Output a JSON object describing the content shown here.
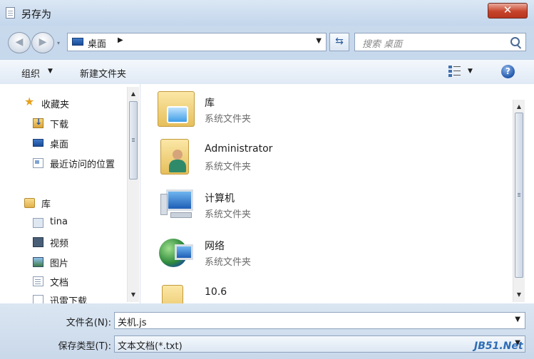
{
  "window": {
    "title": "另存为",
    "close_glyph": "✕"
  },
  "navbar": {
    "back_glyph": "◀",
    "forward_glyph": "▶",
    "recent_glyph": "▾",
    "address_location": "桌面",
    "address_arrow": "▶",
    "address_dropdown_glyph": "▼",
    "refresh_glyph": "⇆",
    "search_placeholder": "搜索 桌面"
  },
  "toolbar": {
    "organize_label": "组织",
    "organize_caret": "▼",
    "new_folder_label": "新建文件夹",
    "view_dropdown_glyph": "▼",
    "help_glyph": "?"
  },
  "nav_pane": {
    "items": [
      {
        "label": "收藏夹",
        "icon": "star-icon"
      },
      {
        "label": "下载",
        "icon": "downloads-icon"
      },
      {
        "label": "桌面",
        "icon": "desktop-icon"
      },
      {
        "label": "最近访问的位置",
        "icon": "recent-places-icon"
      },
      {
        "label": "库",
        "icon": "library-icon"
      },
      {
        "label": "tina",
        "icon": "user-folder-icon"
      },
      {
        "label": "视频",
        "icon": "video-library-icon"
      },
      {
        "label": "图片",
        "icon": "pictures-library-icon"
      },
      {
        "label": "文档",
        "icon": "documents-library-icon"
      },
      {
        "label": "迅雷下载",
        "icon": "thunder-download-icon"
      }
    ],
    "scroll_up_glyph": "▲",
    "scroll_down_glyph": "▼"
  },
  "file_pane": {
    "items": [
      {
        "name": "库",
        "type": "系统文件夹",
        "icon": "library-folder-icon"
      },
      {
        "name": "Administrator",
        "type": "系统文件夹",
        "icon": "user-folder-icon"
      },
      {
        "name": "计算机",
        "type": "系统文件夹",
        "icon": "computer-icon"
      },
      {
        "name": "网络",
        "type": "系统文件夹",
        "icon": "network-icon"
      },
      {
        "name": "10.6",
        "type": "",
        "icon": "folder-icon"
      }
    ],
    "scroll_up_glyph": "▲",
    "scroll_down_glyph": "▼"
  },
  "save_form": {
    "filename_label": "文件名(N):",
    "filename_value": "关机.js",
    "filetype_label": "保存类型(T):",
    "filetype_value": "文本文档(*.txt)",
    "dropdown_glyph": "▼"
  },
  "watermark": "JB51.Net",
  "colors": {
    "accent": "#2f6db5",
    "close": "#c7432b"
  }
}
